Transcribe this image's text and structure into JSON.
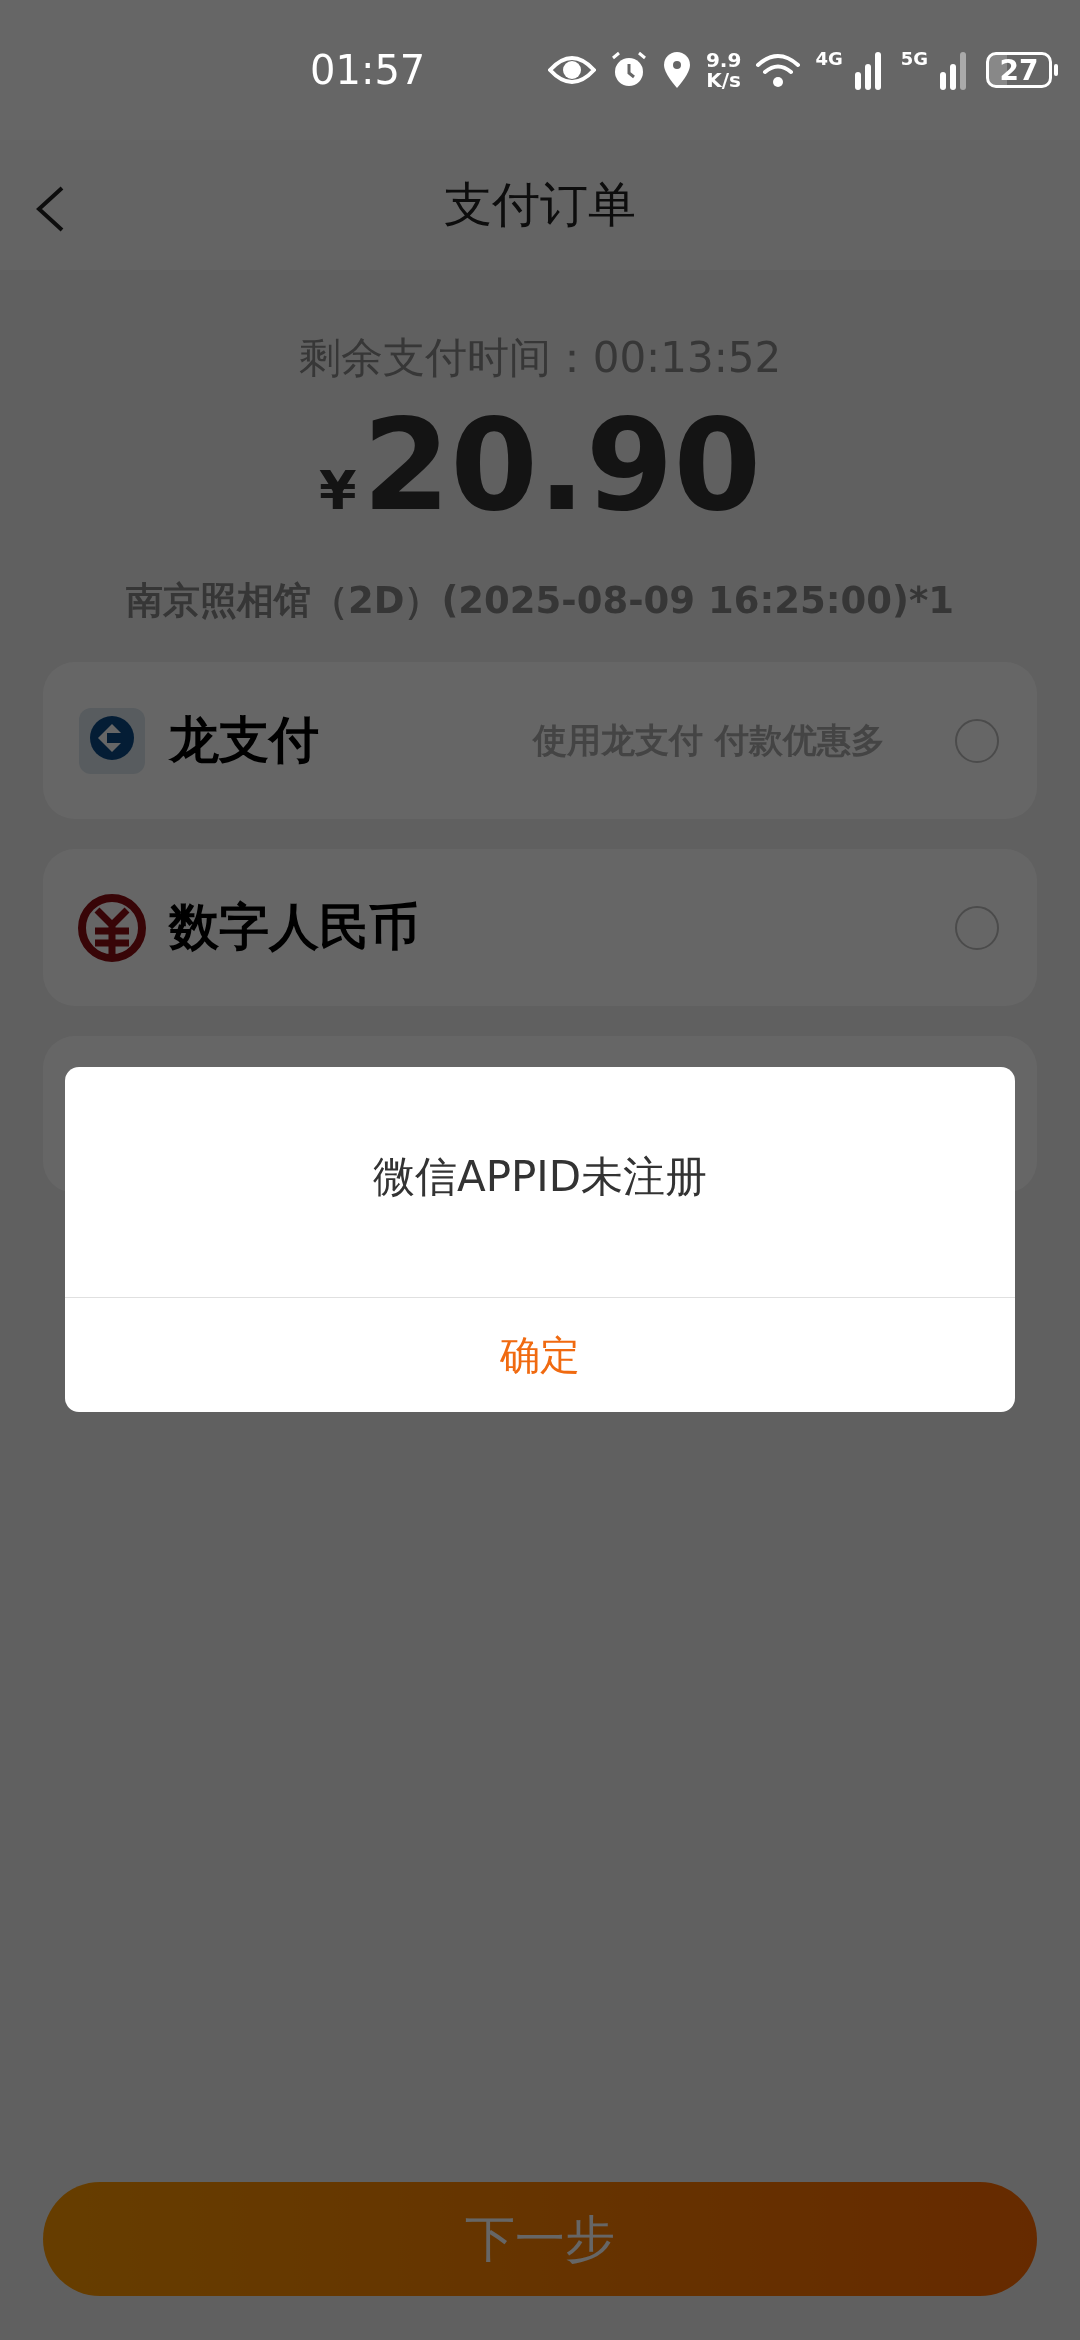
{
  "status_bar": {
    "time": "01:57",
    "network_speed": [
      "9.9",
      "K/s"
    ],
    "network_labels": [
      "4G",
      "5G"
    ],
    "battery": "27"
  },
  "header": {
    "title": "支付订单"
  },
  "order": {
    "countdown": "剩余支付时间：00:13:52",
    "currency": "¥",
    "amount": "20.90",
    "description": "南京照相馆（2D）(2025-08-09 16:25:00)*1"
  },
  "payment_methods": [
    {
      "kind": "dragon",
      "name": "龙支付",
      "promo": "使用龙支付 付款优惠多",
      "selected": false
    },
    {
      "kind": "ecny",
      "name": "数字人民币",
      "selected": false
    }
  ],
  "dialog": {
    "message": "微信APPID未注册",
    "button": "确定"
  },
  "next_button": {
    "label": "下一步"
  }
}
